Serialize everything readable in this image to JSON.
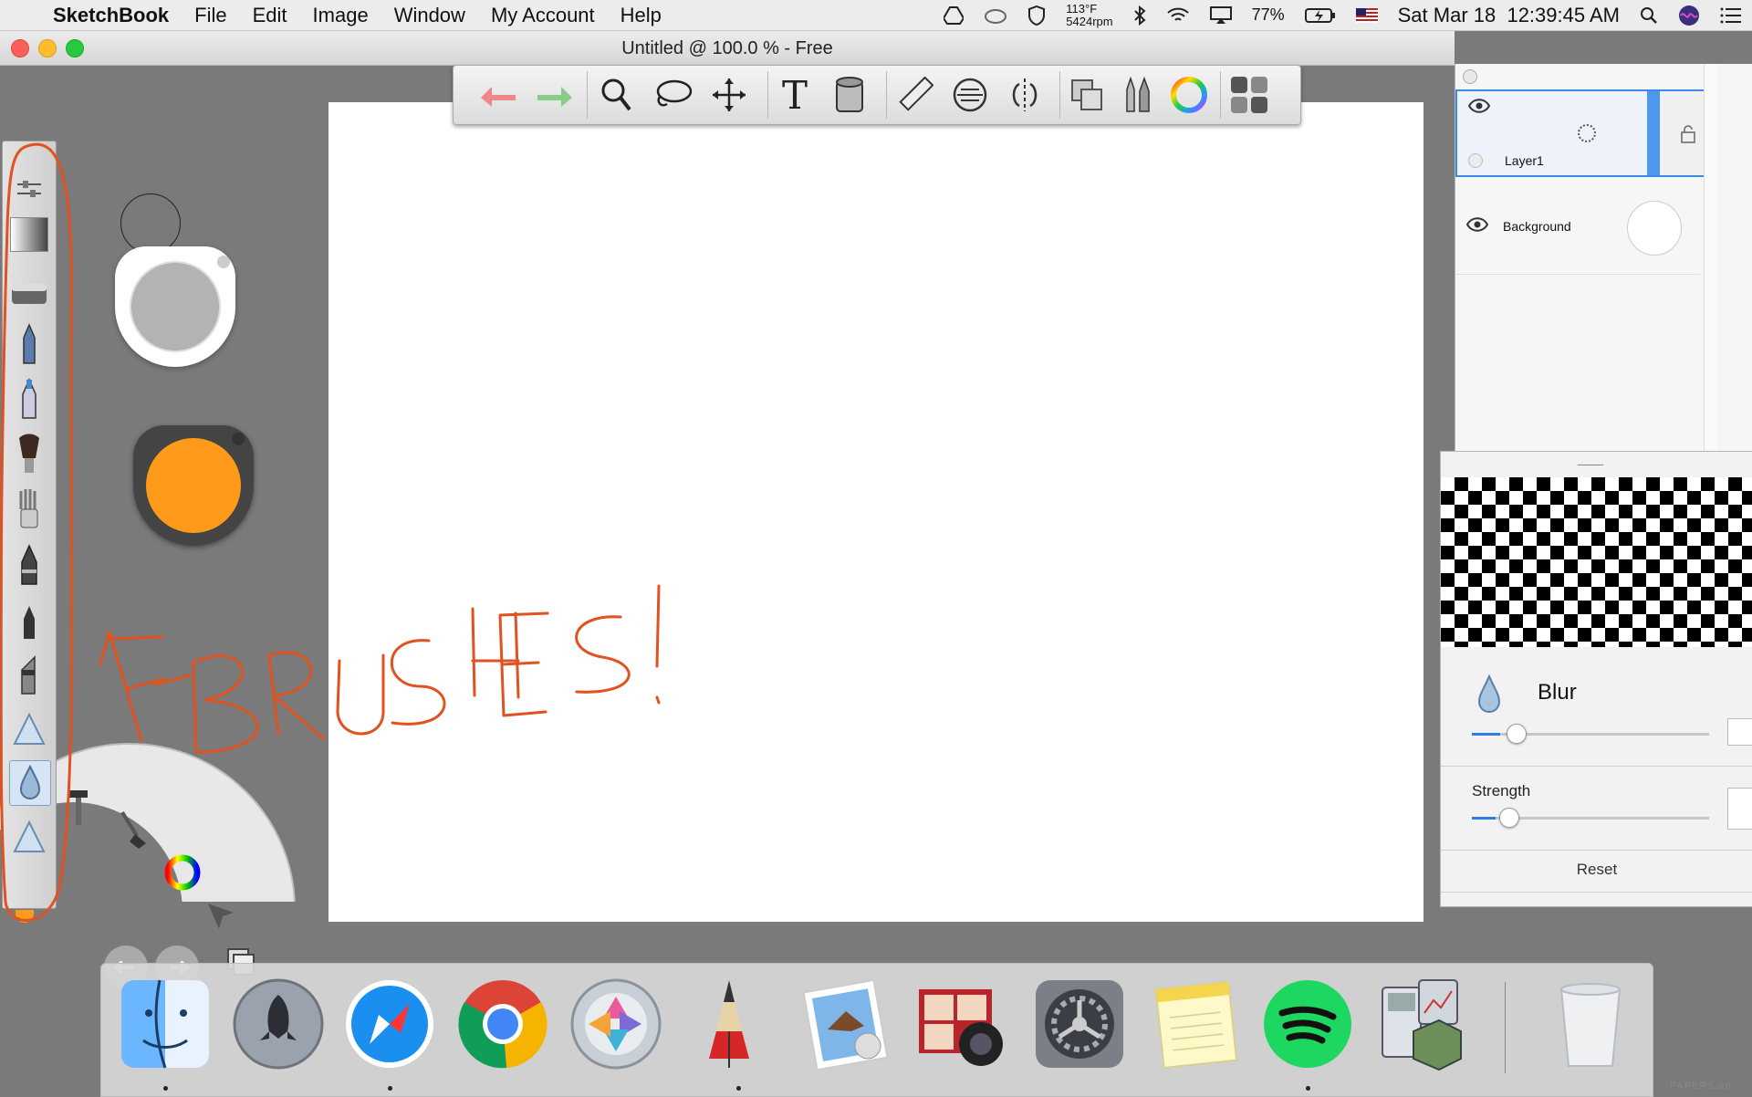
{
  "menubar": {
    "apple": "",
    "app_name": "SketchBook",
    "menus": [
      "File",
      "Edit",
      "Image",
      "Window",
      "My Account",
      "Help"
    ],
    "temp": "113°F",
    "rpm": "5424rpm",
    "battery": "77%",
    "datetime": "Sat Mar 18  12:39:45 AM"
  },
  "window": {
    "title": "Untitled @ 100.0 % - Free"
  },
  "toolbar": {
    "tools": [
      "undo-icon",
      "redo-icon",
      "zoom-icon",
      "lasso-icon",
      "move-icon",
      "text-icon",
      "fill-bucket-icon",
      "ruler-icon",
      "ellipse-guide-icon",
      "symmetry-icon",
      "layers-icon",
      "brush-library-icon",
      "color-wheel-icon",
      "grid-icon"
    ]
  },
  "canvas": {
    "drawing_text": "F-BRUSHES!",
    "stroke_color": "#e0521f"
  },
  "colors": {
    "brush_color": "#ff9a1a",
    "selection_accent": "#3b8ae8"
  },
  "layers": {
    "items": [
      {
        "name": "Layer1",
        "selected": true
      },
      {
        "name": "Background",
        "selected": false
      }
    ]
  },
  "blur_panel": {
    "brush_name": "Blur",
    "size_value": 0.12,
    "strength_label": "Strength",
    "strength_value": 0.1,
    "reset_label": "Reset"
  },
  "dock": {
    "apps": [
      "finder-icon",
      "launchpad-icon",
      "safari-icon",
      "chrome-icon",
      "photo-slideshow-icon",
      "sketchbook-icon",
      "mail-icon",
      "photo-booth-icon",
      "system-preferences-icon",
      "notes-icon",
      "spotify-icon",
      "calculator-icon",
      "trash-icon"
    ]
  },
  "watermark": "PAPERS.co"
}
